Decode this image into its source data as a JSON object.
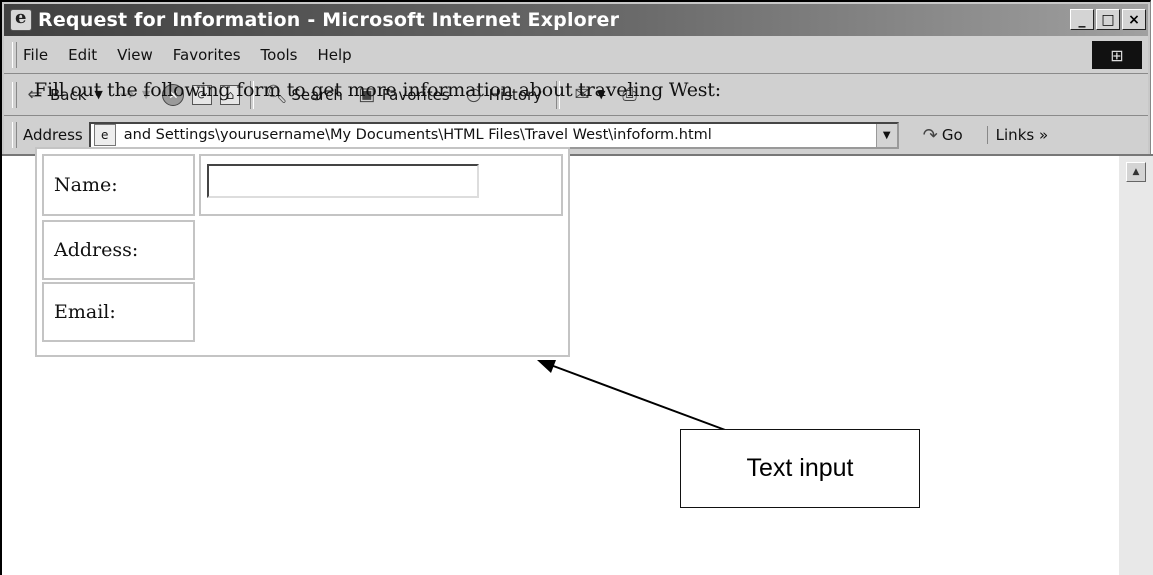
{
  "window": {
    "title": "Request for Information - Microsoft Internet Explorer",
    "buttons": {
      "minimize": "_",
      "maximize": "□",
      "close": "×"
    }
  },
  "menu": [
    "File",
    "Edit",
    "View",
    "Favorites",
    "Tools",
    "Help"
  ],
  "toolbar": {
    "back": "Back",
    "forward": "→",
    "search": "Search",
    "favorites": "Favorites",
    "history": "History"
  },
  "address": {
    "label": "Address",
    "value": "and Settings\\yourusername\\My Documents\\HTML Files\\Travel West\\infoform.html",
    "go": "Go",
    "links": "Links »"
  },
  "page": {
    "intro": "Fill out the following form to get more information about traveling West:",
    "form": {
      "name_label": "Name:",
      "name_value": "",
      "address_label": "Address:",
      "email_label": "Email:"
    }
  },
  "annotation": {
    "callout": "Text input"
  }
}
